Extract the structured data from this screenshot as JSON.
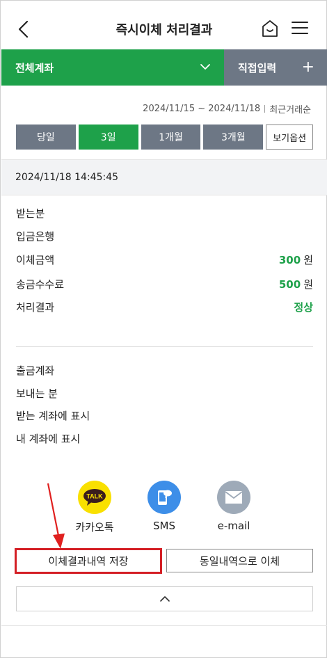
{
  "header": {
    "title": "즉시이체 처리결과",
    "back_icon": "chevron-left-icon",
    "home_icon": "home-icon",
    "menu_icon": "hamburger-menu-icon"
  },
  "account_bar": {
    "select_label": "전체계좌",
    "direct_label": "직접입력",
    "plus": "+"
  },
  "date_range": {
    "range": "2024/11/15 ~ 2024/11/18",
    "order": "최근거래순"
  },
  "period": {
    "buttons": [
      "당일",
      "3일",
      "1개월",
      "3개월"
    ],
    "active_index": 1,
    "view_option": "보기옵션"
  },
  "timestamp": "2024/11/18 14:45:45",
  "details": {
    "recipient": "받는분",
    "bank": "입금은행",
    "amount_label": "이체금액",
    "amount_value": "300",
    "amount_unit": "원",
    "fee_label": "송금수수료",
    "fee_value": "500",
    "fee_unit": "원",
    "result_label": "처리결과",
    "result_value": "정상"
  },
  "details2": {
    "from_account": "출금계좌",
    "sender": "보내는 분",
    "recipient_memo": "받는 계좌에 표시",
    "my_memo": "내 계좌에 표시"
  },
  "share": {
    "kakao_badge": "TALK",
    "kakao": "카카오톡",
    "sms": "SMS",
    "email": "e-mail"
  },
  "actions": {
    "save": "이체결과내역 저장",
    "same": "동일내역으로 이체"
  },
  "colors": {
    "accent_green": "#1ea14a",
    "gray_button": "#6d7785",
    "highlight_red": "#d41f25",
    "kakao_yellow": "#f9e000",
    "sms_blue": "#3d8ee8",
    "email_gray": "#9eaab8"
  }
}
